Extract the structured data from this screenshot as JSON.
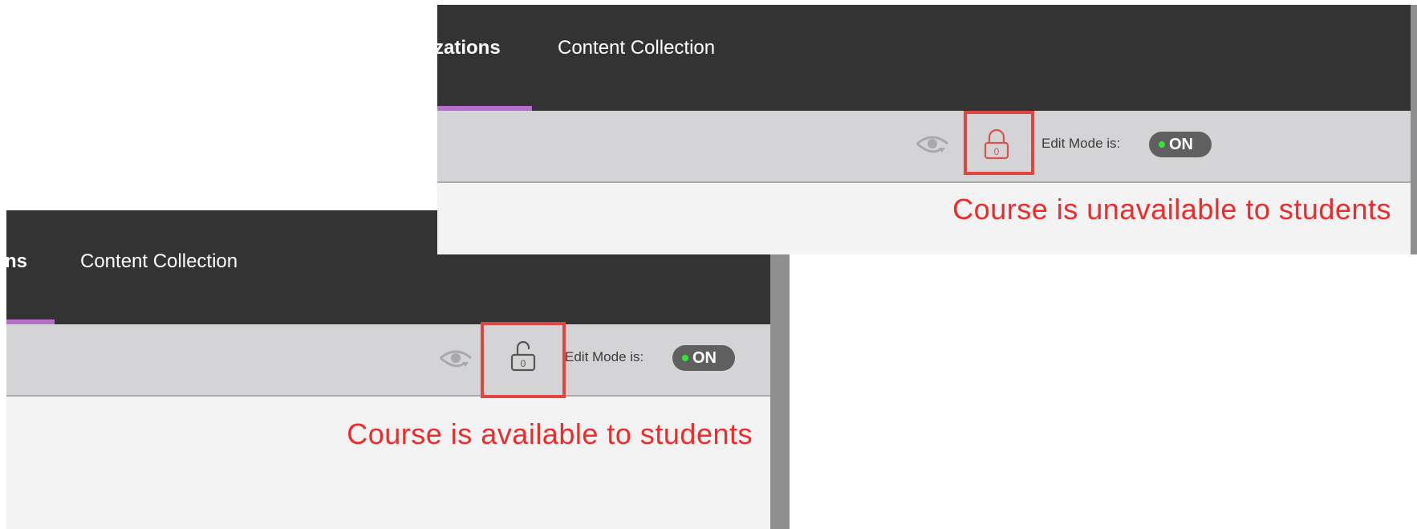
{
  "panels": {
    "unavailable": {
      "nav": {
        "tab_partial": "zations",
        "tab_content_collection": "Content Collection"
      },
      "edit_mode_label": "Edit Mode is:",
      "edit_mode_state": "ON",
      "lock_badge": "0",
      "caption": "Course is unavailable to students"
    },
    "available": {
      "nav": {
        "tab_partial": "ns",
        "tab_content_collection": "Content Collection"
      },
      "edit_mode_label": "Edit Mode is:",
      "edit_mode_state": "ON",
      "lock_badge": "0",
      "caption": "Course is available to students"
    }
  },
  "icons": {
    "preview": "eye-icon",
    "locked": "lock-closed-icon",
    "unlocked": "lock-open-icon"
  },
  "colors": {
    "nav_bg": "#333333",
    "toolbar_bg": "#d4d3d6",
    "content_bg": "#f3f3f3",
    "accent_underline": "#b86fcb",
    "highlight": "#e0463f",
    "caption": "#ee2a2a",
    "toggle_bg": "#5f5f5f",
    "toggle_dot": "#35e535"
  }
}
